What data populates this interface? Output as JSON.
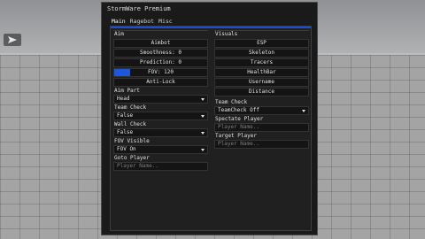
{
  "window": {
    "title": "StormWare Premium"
  },
  "tabs": [
    {
      "label": "Main"
    },
    {
      "label": "Ragebot"
    },
    {
      "label": "Misc"
    }
  ],
  "aim": {
    "title": "Aim",
    "aimbot_label": "Aimbot",
    "smoothness": {
      "label": "Smoothness: 0",
      "level": 0
    },
    "prediction": {
      "label": "Prediction: 0",
      "level": 0
    },
    "fov": {
      "label": "FOV: 120",
      "level": 0.17
    },
    "antilock_label": "Anti-Lock",
    "aim_part": {
      "label": "Aim Part",
      "value": "Head"
    },
    "team_check": {
      "label": "Team Check",
      "value": "False"
    },
    "wall_check": {
      "label": "Wall Check",
      "value": "False"
    },
    "fov_visible": {
      "label": "FOV Visible",
      "value": "FOV On"
    },
    "goto_player": {
      "label": "Goto Player",
      "placeholder": "Player Name.."
    }
  },
  "visuals": {
    "title": "Visuals",
    "buttons": [
      "ESP",
      "Skeleton",
      "Tracers",
      "HealthBar",
      "Username",
      "Distance"
    ],
    "team_check": {
      "label": "Team Check",
      "value": "TeamCheck Off"
    },
    "spectate_player": {
      "label": "Spectate Player",
      "placeholder": "Player Name.."
    },
    "target_player": {
      "label": "Target Player",
      "placeholder": "Player Name.."
    }
  },
  "colors": {
    "accent": "#1d57dc",
    "window_bg": "#1a1a1a",
    "control_bg": "#141414"
  },
  "icons": {
    "chat": "send-arrow-icon"
  }
}
